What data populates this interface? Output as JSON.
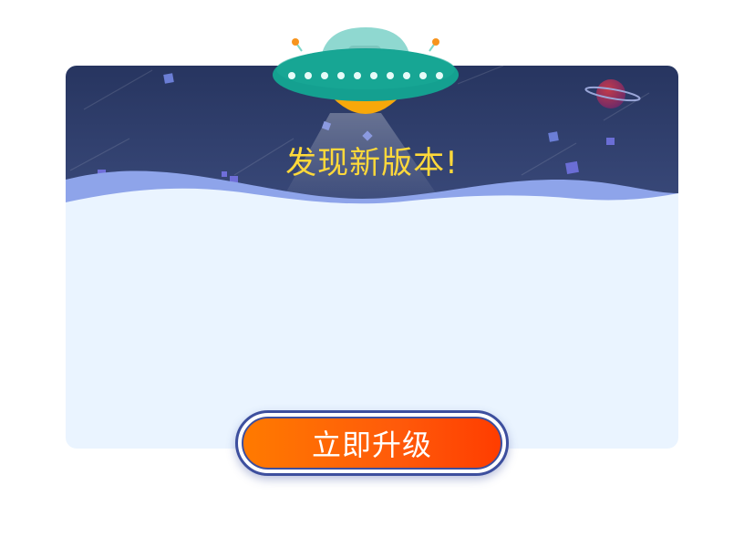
{
  "dialog": {
    "title": "发现新版本!",
    "upgrade_button_label": "立即升级"
  },
  "icons": {
    "ufo": "ufo-icon",
    "planet": "planet-icon",
    "cube": "cube-icon"
  },
  "colors": {
    "banner_top": "#2a3a66",
    "banner_bottom": "#3a4a7a",
    "wave": "#8ea4ea",
    "body": "#eaf4ff",
    "title": "#ffd93a",
    "button_start": "#ff7a00",
    "button_end": "#ff3d00",
    "button_border": "#3d4f9e"
  }
}
